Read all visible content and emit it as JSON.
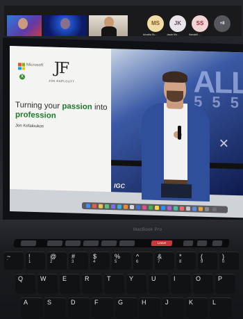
{
  "zoom_gallery": {
    "participants": [
      {
        "initials": "MS",
        "name": "Monella Ss..."
      },
      {
        "initials": "JK",
        "name": "Jacob Kin..."
      },
      {
        "initials": "SS",
        "name": "Sanskriti ..."
      }
    ],
    "more_label": "+8"
  },
  "slide": {
    "brand_left": "Microsoft",
    "logo_text": "JF",
    "logo_sub": "JON KAPLOUTT",
    "title_prefix": "Turning your ",
    "title_accent1": "passion",
    "title_middle": " into ",
    "title_accent2": "profession",
    "author": "Jon Kefaloukos"
  },
  "stage": {
    "big_text": "ALL",
    "big_text2": "5 5 5",
    "logo": "IGC"
  },
  "laptop": {
    "brand": "MacBook Pro",
    "leave_label": "Leave"
  },
  "keyboard": {
    "row1": [
      "~",
      "!",
      "@",
      "#",
      "$",
      "%",
      "^",
      "&",
      "*",
      "(",
      ")"
    ],
    "row1_sub": [
      "`",
      "1",
      "2",
      "3",
      "4",
      "5",
      "6",
      "7",
      "8",
      "9",
      "0"
    ],
    "row2": [
      "Q",
      "W",
      "E",
      "R",
      "T",
      "Y",
      "U",
      "I",
      "O",
      "P"
    ],
    "row3": [
      "A",
      "S",
      "D",
      "F",
      "G",
      "H",
      "J",
      "K",
      "L"
    ]
  },
  "colors": {
    "accent_green": "#1f7a2f",
    "leave_red": "#c53a3a",
    "suit_blue": "#2f4f9a"
  }
}
